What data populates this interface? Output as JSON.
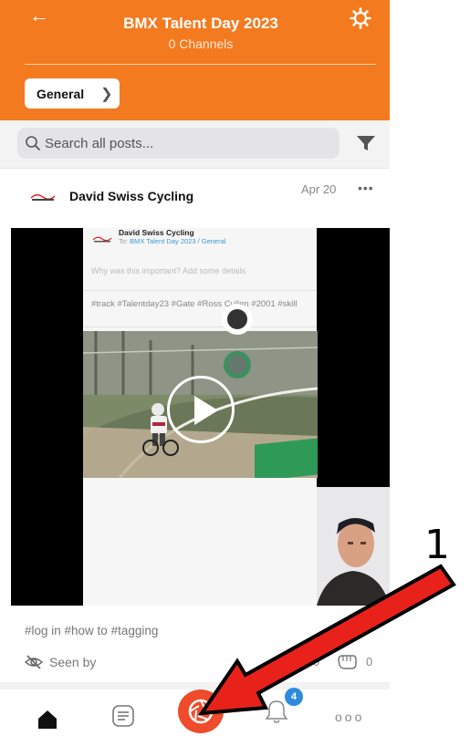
{
  "header": {
    "title": "BMX Talent Day 2023",
    "subtitle": "0 Channels",
    "channel_button": "General"
  },
  "search": {
    "placeholder": "Search all posts..."
  },
  "post": {
    "author": "David Swiss Cycling",
    "date": "Apr 20",
    "more": "•••",
    "embedded": {
      "author": "David Swiss Cycling",
      "to_prefix": "To: ",
      "to_target": "BMX Talent Day 2023 / General",
      "prompt": "Why was this important? Add some details",
      "tags": "#track  #Talentday23  #Gate  #Ross Cullen  #2001  #skill"
    },
    "tags": "#log in  #how to  #tagging",
    "seen_by": "Seen by",
    "comment_count": "0",
    "reaction_count": "0"
  },
  "nav": {
    "notification_badge": "4",
    "more": "ooo"
  },
  "annotation": {
    "number": "1"
  },
  "colors": {
    "header_orange": "#f47a1f",
    "camera_red": "#ef4b2c",
    "badge_blue": "#2f8cdd",
    "arrow_red": "#e8221b"
  },
  "icons": [
    "back-arrow-icon",
    "gear-icon",
    "chevron-right-icon",
    "search-icon",
    "filter-icon",
    "play-icon",
    "eye-slash-icon",
    "fist-icon",
    "home-icon",
    "posts-icon",
    "camera-icon",
    "bell-icon",
    "more-icon"
  ]
}
